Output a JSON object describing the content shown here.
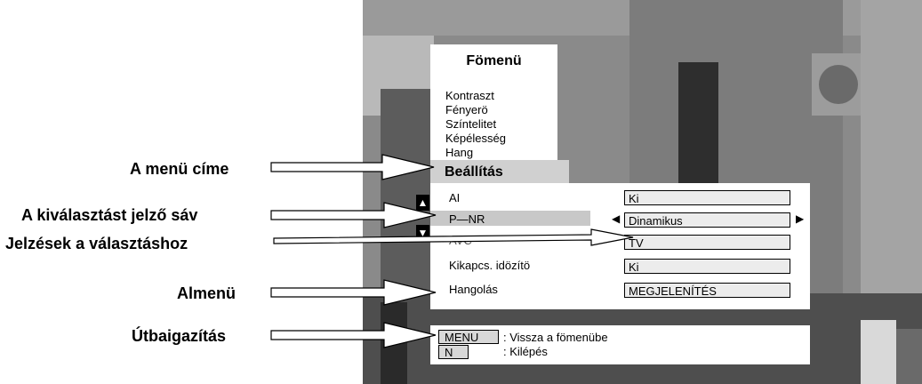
{
  "callouts": {
    "menu_title": "A menü címe",
    "selection_bar": "A kiválasztást jelző sáv",
    "choice_markers": "Jelzések a választáshoz",
    "submenu": "Almenü",
    "guide": "Útbaigazítás"
  },
  "main_menu": {
    "title": "Fömenü",
    "items": [
      "Kontraszt",
      "Fényerö",
      "Színtelitet",
      "Képélesség",
      "Hang"
    ]
  },
  "submenu": {
    "title": "Beállítás",
    "items": [
      {
        "label": "AI",
        "value": "Ki"
      },
      {
        "label": "P—NR",
        "value": "Dinamikus"
      },
      {
        "label": "AVC",
        "value": "TV"
      },
      {
        "label": "Kikapcs. idözítö",
        "value": "Ki"
      },
      {
        "label": "Hangolás",
        "value": "MEGJELENÍTÉS"
      }
    ]
  },
  "help": {
    "rows": [
      {
        "key": "MENU",
        "text": ": Vissza a fömenübe"
      },
      {
        "key": "N",
        "text": ": Kilépés"
      }
    ]
  },
  "icons": {
    "left_arrow": "triangle-left-icon",
    "right_arrow": "triangle-right-icon",
    "scroll_up": "scroll-up-icon",
    "scroll_down": "scroll-down-icon"
  }
}
